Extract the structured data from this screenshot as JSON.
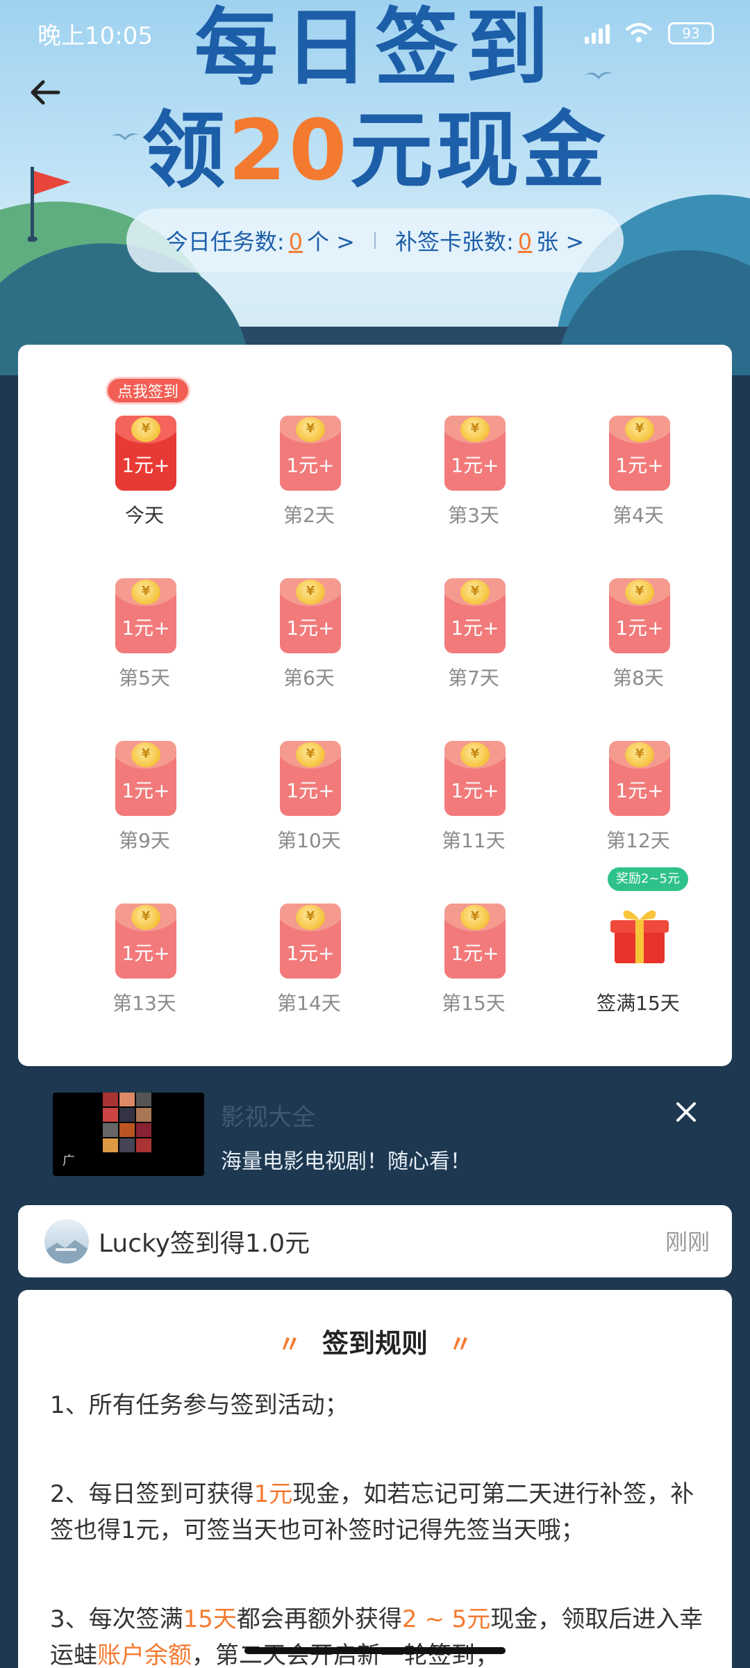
{
  "status_bar": {
    "time": "晚上10:05",
    "battery": "93"
  },
  "header": {
    "title_line1": "每日签到",
    "title_line2_prefix": "领",
    "title_line2_amount": "20",
    "title_line2_suffix": "元现金",
    "tasks_label": "今日任务数:",
    "tasks_count": "0",
    "tasks_unit": "个 >",
    "cards_label": "补签卡张数:",
    "cards_count": "0",
    "cards_unit": "张 >"
  },
  "signin": {
    "today_tag": "点我签到",
    "bonus_tag": "奖励2~5元",
    "days": [
      {
        "label": "今天",
        "amount": "1元+"
      },
      {
        "label": "第2天",
        "amount": "1元+"
      },
      {
        "label": "第3天",
        "amount": "1元+"
      },
      {
        "label": "第4天",
        "amount": "1元+"
      },
      {
        "label": "第5天",
        "amount": "1元+"
      },
      {
        "label": "第6天",
        "amount": "1元+"
      },
      {
        "label": "第7天",
        "amount": "1元+"
      },
      {
        "label": "第8天",
        "amount": "1元+"
      },
      {
        "label": "第9天",
        "amount": "1元+"
      },
      {
        "label": "第10天",
        "amount": "1元+"
      },
      {
        "label": "第11天",
        "amount": "1元+"
      },
      {
        "label": "第12天",
        "amount": "1元+"
      },
      {
        "label": "第13天",
        "amount": "1元+"
      },
      {
        "label": "第14天",
        "amount": "1元+"
      },
      {
        "label": "第15天",
        "amount": "1元+"
      },
      {
        "label": "签满15天",
        "amount": ""
      }
    ],
    "coin_symbol": "¥"
  },
  "ad": {
    "title": "影视大全",
    "description": "海量电影电视剧！随心看！",
    "mark": "广"
  },
  "notice": {
    "message": "Lucky签到得1.0元",
    "time": "刚刚"
  },
  "rules": {
    "title": "签到规则",
    "rule1": "1、所有任务参与签到活动；",
    "rule2_a": "2、每日签到可获得",
    "rule2_hl": "1元",
    "rule2_b": "现金，如若忘记可第二天进行补签，补签也得1元，可签当天也可补签时记得先签当天哦；",
    "rule3_a": "3、每次签满",
    "rule3_hl1": "15天",
    "rule3_b": "都会再额外获得",
    "rule3_hl2": "2 ~ 5元",
    "rule3_c": "现金，领取后进入幸运蛙",
    "rule3_hl3": "账户余额",
    "rule3_d": "，第二天会开启新一轮签到；"
  },
  "colors": {
    "brand_blue": "#1d5ea8",
    "accent_orange": "#f47a30",
    "packet_red": "#f27a7a",
    "today_red": "#e83a35",
    "bonus_green": "#2ec28a"
  }
}
